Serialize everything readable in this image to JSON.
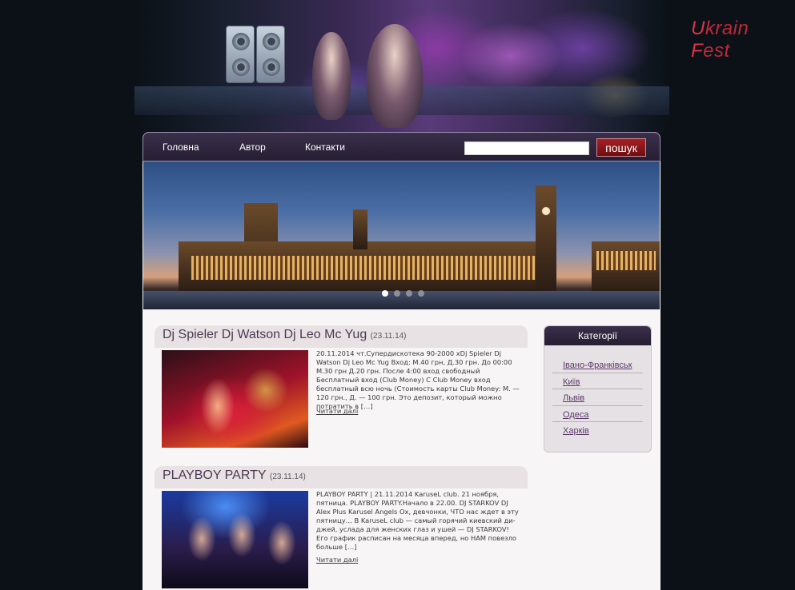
{
  "header": {
    "logo_text_u": "U",
    "logo_text_rest": "krain ",
    "logo_text_f": "F",
    "logo_text_end": "est"
  },
  "nav": {
    "items": [
      {
        "label": "Головна"
      },
      {
        "label": "Автор"
      },
      {
        "label": "Контакти"
      }
    ],
    "search_value": "",
    "search_button": "пошук"
  },
  "slider": {
    "slide_count": 4,
    "active_index": 0
  },
  "posts": [
    {
      "title": "Dj Spieler Dj Watson Dj Leo Mc Yug",
      "date": "(23.11.14)",
      "excerpt": "20.11.2014 чт.Супердискотека 90-2000 xDj Spieler Dj Watson Dj Leo Mc Yug Вход: М.40 грн, Д.30 грн. До 00:00 М.30 грн Д.20 грн. После 4:00 вход свободный Бесплатный вход (Club Money) С Club Money вход бесплатный всю ночь (Стоимость карты Club Money: М. — 120 грн., Д. — 100 грн. Это депозит, который можно потратить в […]",
      "read_more": "Читати далі"
    },
    {
      "title": "PLAYBOY PARTY",
      "date": "(23.11.14)",
      "excerpt": "PLAYBOY PARTY | 21.11.2014 KaruseL club. 21 ноября, пятница. PLAYBOY PARTY.Начало в 22.00. DJ STARKOV DJ Alex Plus Karusel Angels Ох, девчонки, ЧТО нас ждет в эту пятницу… В KaruseL club — самый горячий киевский ди-джей, услада для женских глаз и ушей — DJ STARKOV! Его график расписан на месяца вперед, но НАМ повезло больше […]",
      "read_more": "Читати далі"
    }
  ],
  "categories": {
    "title": "Категорії",
    "items": [
      {
        "label": "Івано-Франківськ"
      },
      {
        "label": "Київ"
      },
      {
        "label": "Львів"
      },
      {
        "label": "Одеса"
      },
      {
        "label": "Харків"
      }
    ]
  },
  "colors": {
    "background": "#0b1116",
    "nav_bar": "#2f2540",
    "search_button": "#8a161b",
    "logo": "#c0283a",
    "link": "#5b3a6a"
  }
}
